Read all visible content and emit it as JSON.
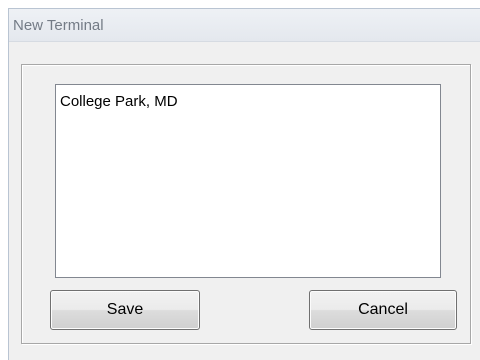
{
  "window": {
    "title": "New Terminal"
  },
  "terminal_list": {
    "items": [
      "College Park, MD"
    ]
  },
  "buttons": {
    "save_label": "Save",
    "cancel_label": "Cancel"
  }
}
